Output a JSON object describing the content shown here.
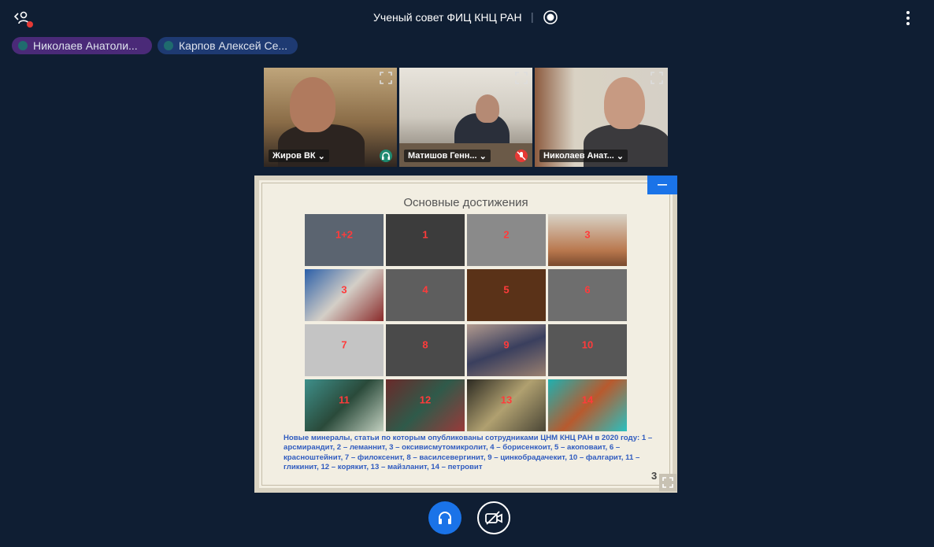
{
  "header": {
    "title": "Ученый совет ФИЦ КНЦ РАН",
    "icons": {
      "participants": "participants-icon",
      "record": "record-icon",
      "more": "more-vertical-icon"
    }
  },
  "chips": [
    {
      "label": "Николаев Анатоли..."
    },
    {
      "label": "Карпов Алексей Се..."
    }
  ],
  "tiles": [
    {
      "name": "Жиров ВК",
      "status_icon": "headphones-icon"
    },
    {
      "name": "Матишов Генн...",
      "status_icon": "muted-mic-icon"
    },
    {
      "name": "Николаев Анат...",
      "status_icon": ""
    }
  ],
  "slide": {
    "title": "Основные достижения",
    "numbers": [
      "1+2",
      "1",
      "2",
      "3",
      "3",
      "4",
      "5",
      "6",
      "7",
      "8",
      "9",
      "10",
      "11",
      "12",
      "13",
      "14"
    ],
    "caption": "Новые минералы, статьи по которым опубликованы сотрудниками ЦНМ КНЦ РАН в 2020 году: 1 – арсмирандит, 2 – леманнит, 3 – оксивисмутомикролит, 4 – борисенкоит, 5 – акоповаит, 6 – красноштейнит, 7 – филоксенит, 8 – василсевергинит, 9 – цинкобрадачекит, 10 – фалгарит, 11 – гликинит, 12 – корякит, 13 – майзланит, 14 – петровит",
    "page": "3"
  },
  "controls": {
    "audio": "headphones-icon",
    "video": "video-off-icon"
  },
  "colors": {
    "background": "#0f1e33",
    "accent": "#1a73e8"
  }
}
